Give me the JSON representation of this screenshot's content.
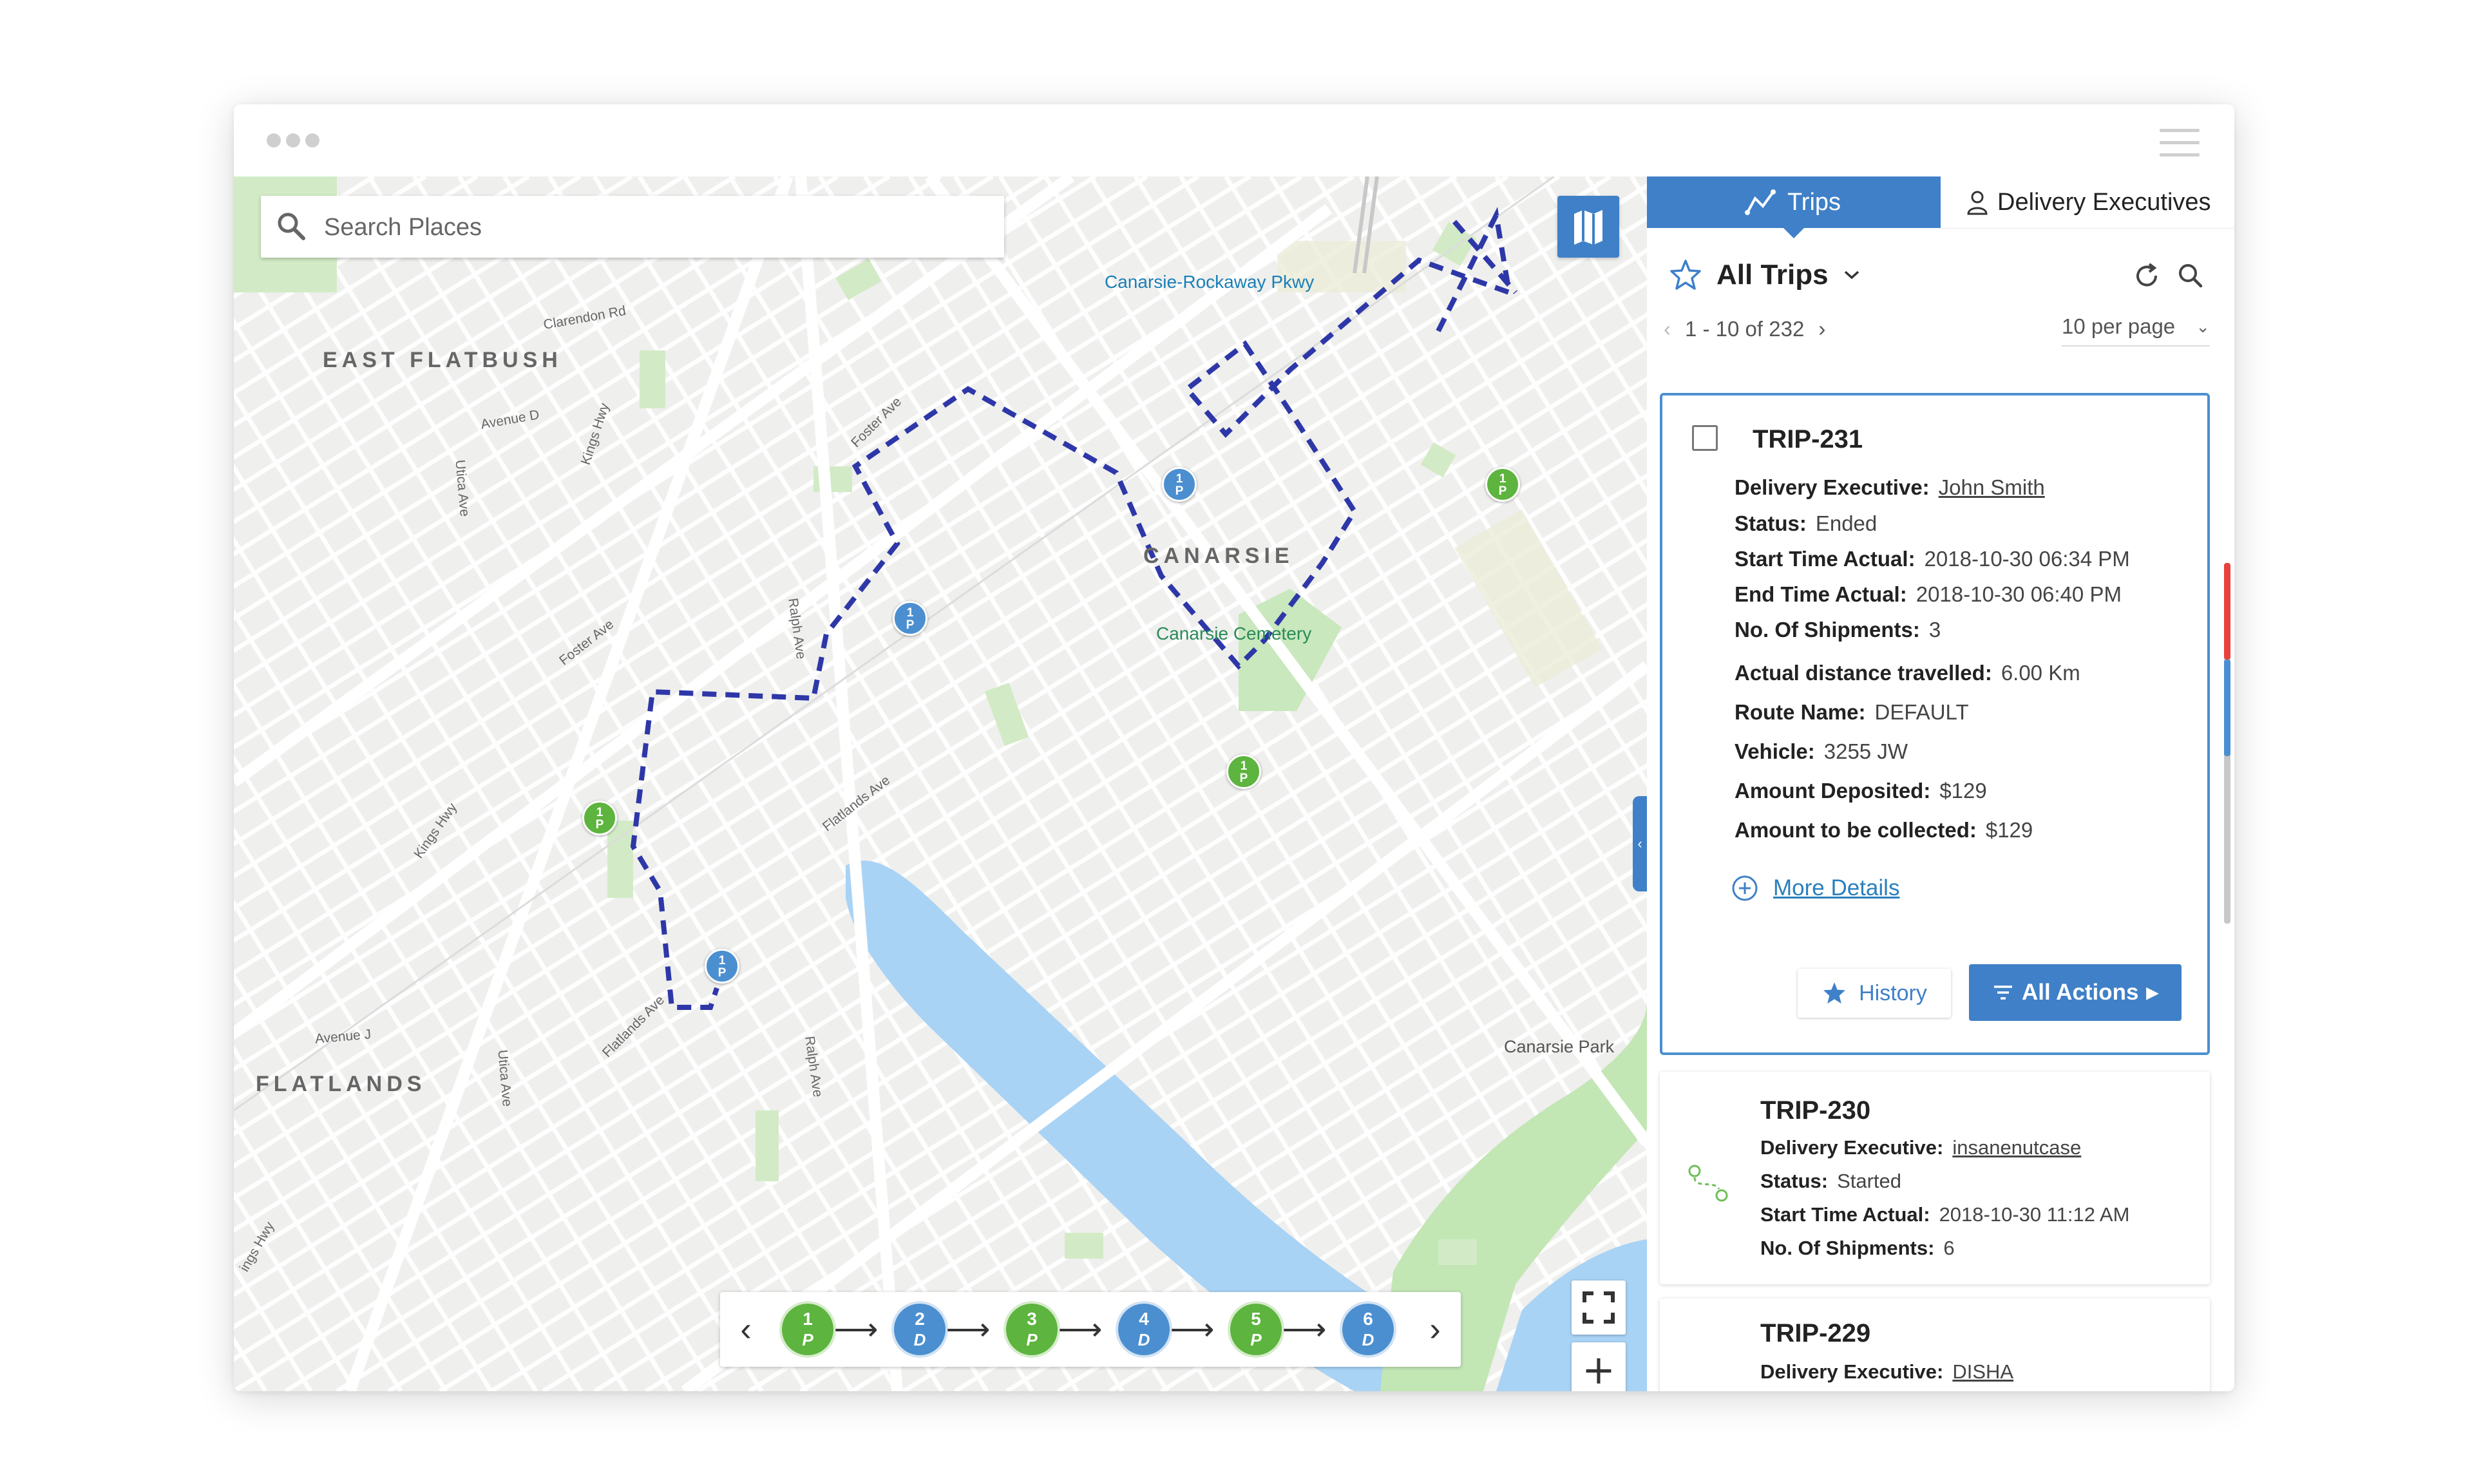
{
  "window": {
    "dots": [
      "window-dot-1",
      "window-dot-2",
      "window-dot-3"
    ]
  },
  "map": {
    "search": {
      "placeholder": "Search Places",
      "value": ""
    },
    "labels": {
      "east_flatbush": "EAST FLATBUSH",
      "canarsie": "CANARSIE",
      "flatlands": "FLATLANDS",
      "canarsie_rockaway": "Canarsie-Rockaway Pkwy",
      "canarsie_cemetery": "Canarsie Cemetery",
      "canarsie_park": "Canarsie Park",
      "clarendon_rd": "Clarendon Rd",
      "avenue_d": "Avenue D",
      "kings_hwy": "Kings Hwy",
      "kings_hwy_2": "Kings Hwy",
      "utica_ave": "Utica Ave",
      "utica_ave_2": "Utica Ave",
      "foster_ave": "Foster Ave",
      "foster_ave_2": "Foster Ave",
      "ralph_ave": "Ralph Ave",
      "ralph_ave_2": "Ralph Ave",
      "flatlands_ave": "Flatlands Ave",
      "flatlands_ave_2": "Flatlands Ave",
      "avenue_j": "Avenue J",
      "kings_hwy_3": "ings Hwy"
    },
    "markers": [
      {
        "top": "1",
        "bottom": "P",
        "color": "blue"
      },
      {
        "top": "1",
        "bottom": "P",
        "color": "green"
      },
      {
        "top": "1",
        "bottom": "P",
        "color": "blue"
      },
      {
        "top": "1",
        "bottom": "P",
        "color": "green"
      },
      {
        "top": "1",
        "bottom": "P",
        "color": "green"
      },
      {
        "top": "1",
        "bottom": "P",
        "color": "blue"
      }
    ],
    "zoom_in": "+",
    "zoom_out": "−",
    "steps": [
      {
        "num": "1",
        "type": "P",
        "color": "green"
      },
      {
        "num": "2",
        "type": "D",
        "color": "blue"
      },
      {
        "num": "3",
        "type": "P",
        "color": "green"
      },
      {
        "num": "4",
        "type": "D",
        "color": "blue"
      },
      {
        "num": "5",
        "type": "P",
        "color": "green"
      },
      {
        "num": "6",
        "type": "D",
        "color": "blue"
      }
    ],
    "step_prev": "‹",
    "step_next": "›",
    "step_arrow": "⟶"
  },
  "panel": {
    "tabs": {
      "trips": "Trips",
      "delivery_executives": "Delivery Executives"
    },
    "header": {
      "title": "All Trips"
    },
    "pager": {
      "range": "1 - 10 of 232",
      "per_page": "10 per page"
    },
    "trips": [
      {
        "id": "TRIP-231",
        "fields": {
          "delivery_executive_label": "Delivery Executive:",
          "delivery_executive": "John Smith",
          "status_label": "Status:",
          "status": "Ended",
          "start_label": "Start Time Actual:",
          "start": "2018-10-30 06:34 PM",
          "end_label": "End Time Actual:",
          "end": "2018-10-30 06:40 PM",
          "shipments_label": "No. Of Shipments:",
          "shipments": "3",
          "distance_label": "Actual distance travelled:",
          "distance": "6.00 Km",
          "route_label": "Route Name:",
          "route": "DEFAULT",
          "vehicle_label": "Vehicle:",
          "vehicle": "3255 JW",
          "deposited_label": "Amount Deposited:",
          "deposited": "$129",
          "collect_label": "Amount to be collected:",
          "collect": "$129"
        },
        "more_details": "More Details",
        "history": "History",
        "all_actions": "All Actions"
      },
      {
        "id": "TRIP-230",
        "fields": {
          "delivery_executive_label": "Delivery Executive:",
          "delivery_executive": "insanenutcase",
          "status_label": "Status:",
          "status": "Started",
          "start_label": "Start Time Actual:",
          "start": "2018-10-30 11:12 AM",
          "shipments_label": "No. Of Shipments:",
          "shipments": "6"
        }
      },
      {
        "id": "TRIP-229",
        "fields": {
          "delivery_executive_label": "Delivery Executive:",
          "delivery_executive": "DISHA"
        }
      }
    ]
  },
  "colors": {
    "accent": "#3f80c8",
    "route": "#2e37a8",
    "water": "#a9d3f5",
    "park": "#c3e6b5",
    "marker_green": "#5db43e",
    "marker_blue": "#4b8fd0"
  }
}
